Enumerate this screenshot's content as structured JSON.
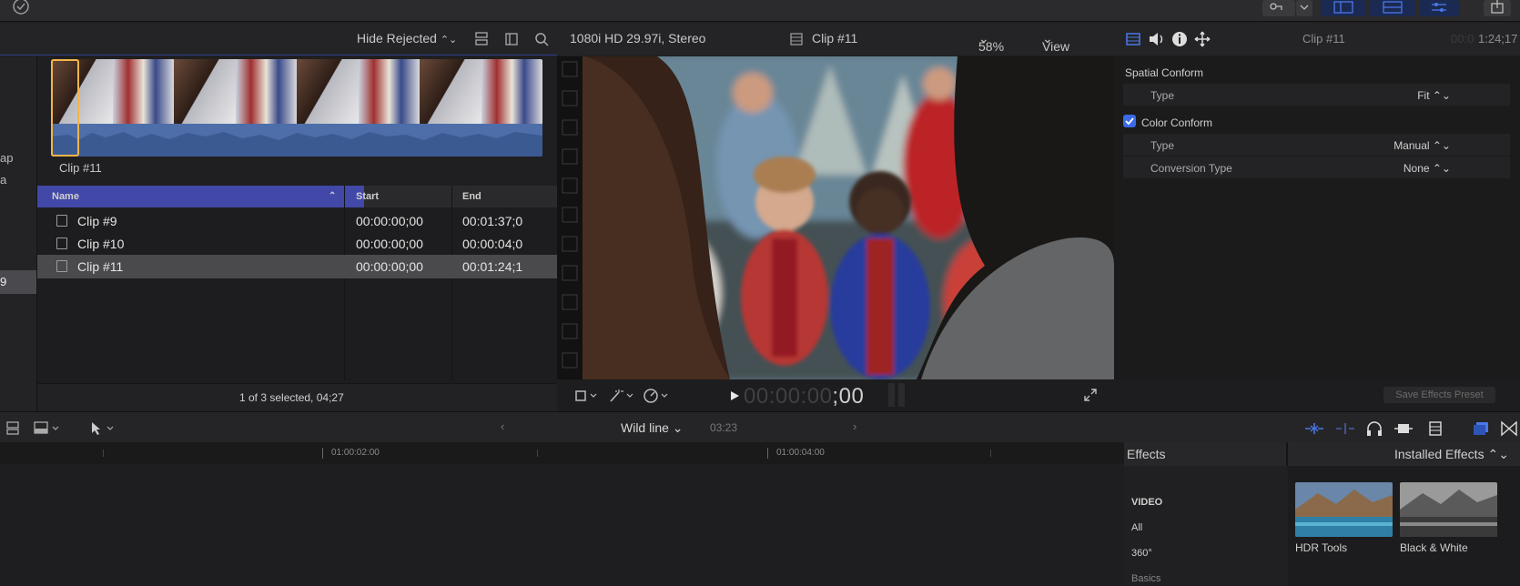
{
  "browser": {
    "filter_label": "Hide Rejected",
    "left_rail": [
      "ap",
      "a",
      "9"
    ],
    "filmstrip_clip_label": "Clip #11",
    "columns": [
      "Name",
      "Start",
      "End"
    ],
    "rows": [
      {
        "name": "Clip #9",
        "start": "00:00:00;00",
        "end": "00:01:37;0"
      },
      {
        "name": "Clip #10",
        "start": "00:00:00;00",
        "end": "00:00:04;0"
      },
      {
        "name": "Clip #11",
        "start": "00:00:00;00",
        "end": "00:01:24;1"
      }
    ],
    "selection_status": "1 of 3 selected, 04;27"
  },
  "viewer": {
    "format": "1080i HD 29.97i, Stereo",
    "clip_name": "Clip #11",
    "zoom": "58%",
    "view_label": "View",
    "timecode_dim": "00:00:00",
    "timecode_lit": ";00"
  },
  "inspector": {
    "clip_name": "Clip #11",
    "duration": "1:24;17",
    "spatial_conform_label": "Spatial Conform",
    "type_label": "Type",
    "type_value": "Fit",
    "color_conform_label": "Color Conform",
    "color_type_label": "Type",
    "color_type_value": "Manual",
    "conversion_type_label": "Conversion Type",
    "conversion_type_value": "None",
    "save_preset_label": "Save Effects Preset"
  },
  "timeline": {
    "index_label": "Wild line",
    "duration": "03:23",
    "ruler_marks": [
      "01:00:02:00",
      "01:00:04:00"
    ]
  },
  "effects": {
    "title": "Effects",
    "source": "Installed Effects",
    "categories": [
      "VIDEO",
      "All",
      "360°",
      "Basics"
    ],
    "items": [
      {
        "label": "HDR Tools"
      },
      {
        "label": "Black & White"
      }
    ]
  },
  "colors": {
    "selection_blue": "#4148a8",
    "clip_orange": "#f3b54a",
    "waveform": "#4d6ea8",
    "checkbox": "#3a6be8"
  },
  "icons": [
    "check-circle-icon",
    "keyword-icon",
    "layout-icon",
    "search-icon",
    "film-icon",
    "audio-icon",
    "info-icon",
    "transform-icon",
    "crop-icon",
    "magic-wand-icon",
    "speed-icon",
    "play-icon",
    "fullscreen-icon",
    "arrow-tool-icon",
    "headphones-icon",
    "share-icon"
  ]
}
